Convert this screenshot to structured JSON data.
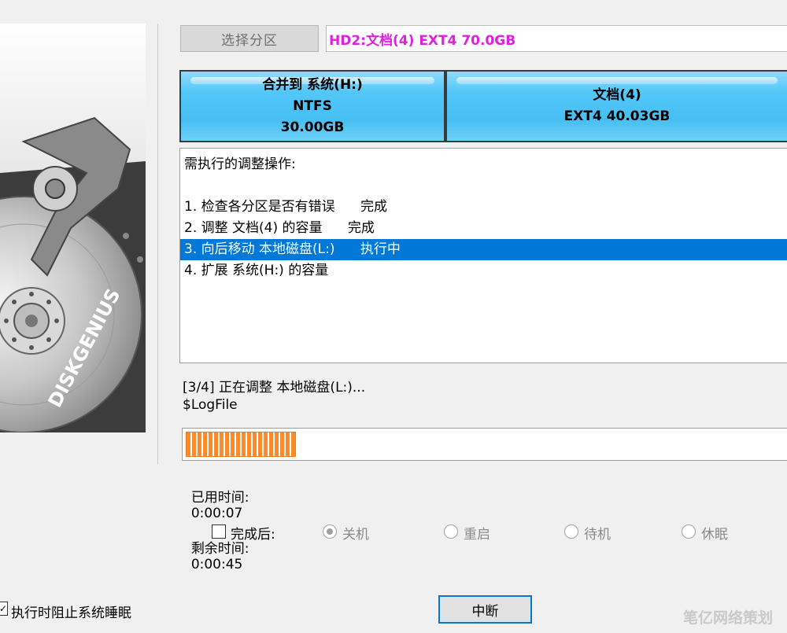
{
  "header": {
    "select_button_label": "选择分区",
    "partition_info": "HD2:文档(4)  EXT4  70.0GB"
  },
  "partitions": [
    {
      "line1": "合并到 系统(H:)",
      "line2": "NTFS",
      "line3": "30.00GB"
    },
    {
      "line1": "文档(4)",
      "line2": "EXT4 40.03GB"
    }
  ],
  "operations": {
    "heading": "需执行的调整操作:",
    "items": [
      "1. 检查各分区是否有错误      完成",
      "2. 调整 文档(4) 的容量      完成",
      "3. 向后移动 本地磁盘(L:)      执行中",
      "4. 扩展 系统(H:) 的容量"
    ],
    "selected_index": 2
  },
  "status": {
    "step_text": "[3/4] 正在调整 本地磁盘(L:)...",
    "current_file": "$LogFile",
    "progress_fraction": 0.184,
    "elapsed_label": "已用时间:",
    "elapsed_value": "0:00:07",
    "remaining_label": "剩余时间:",
    "remaining_value": "0:00:45"
  },
  "after_completion": {
    "label": "完成后:",
    "checked": false,
    "options": [
      "关机",
      "重启",
      "待机",
      "休眠"
    ],
    "selected_option": "关机"
  },
  "prevent_sleep_label": "执行时阻止系统睡眠",
  "abort_button_label": "中断",
  "art": {
    "logo_text": "DISKGENIUS"
  },
  "watermark": "笔亿网络策划",
  "colors": {
    "accent": "#0078d7",
    "partition_info": "#e020e0",
    "partition_fill": "#46bff3",
    "progress": "#ff8a2a"
  }
}
